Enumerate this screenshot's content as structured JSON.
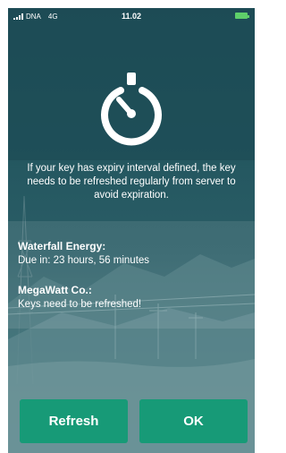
{
  "status_bar": {
    "carrier": "DNA",
    "network": "4G",
    "time": "11.02"
  },
  "icons": {
    "timer": "timer-icon",
    "signal": "signal-icon",
    "battery": "battery-icon"
  },
  "colors": {
    "accent": "#179a77",
    "battery": "#5ecf6a",
    "background": "#23565f"
  },
  "message": "If your key has expiry interval defined, the key needs to be refreshed regularly from server to avoid expiration.",
  "keys": [
    {
      "name": "Waterfall Energy:",
      "status": "Due in: 23 hours, 56 minutes"
    },
    {
      "name": "MegaWatt Co.:",
      "status": "Keys need to be refreshed!"
    }
  ],
  "buttons": {
    "refresh": "Refresh",
    "ok": "OK"
  }
}
